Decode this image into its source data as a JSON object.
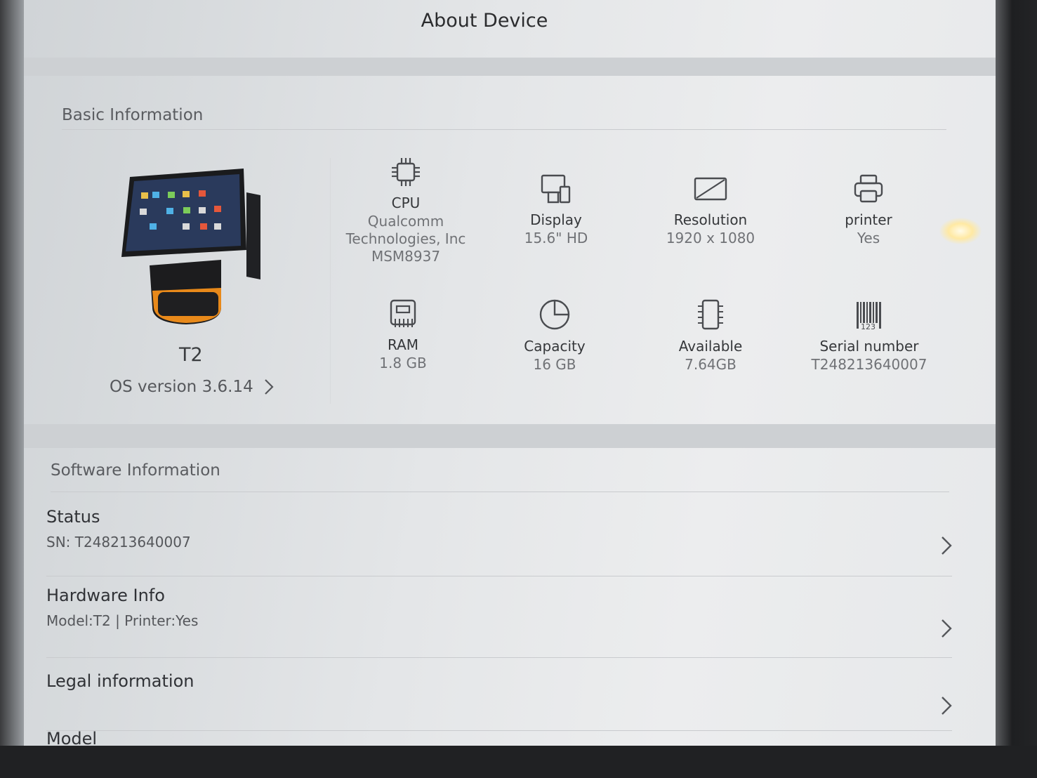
{
  "page": {
    "title": "About Device"
  },
  "basic": {
    "heading": "Basic Information",
    "device_name": "T2",
    "os_version": "OS version 3.6.14",
    "specs": [
      {
        "icon": "cpu-icon",
        "label": "CPU",
        "value": "Qualcomm\nTechnologies, Inc\nMSM8937"
      },
      {
        "icon": "display-icon",
        "label": "Display",
        "value": "15.6\" HD"
      },
      {
        "icon": "resolution-icon",
        "label": "Resolution",
        "value": "1920 x 1080"
      },
      {
        "icon": "printer-icon",
        "label": "printer",
        "value": "Yes"
      },
      {
        "icon": "ram-icon",
        "label": "RAM",
        "value": "1.8 GB"
      },
      {
        "icon": "capacity-icon",
        "label": "Capacity",
        "value": "16 GB"
      },
      {
        "icon": "available-icon",
        "label": "Available",
        "value": "7.64GB"
      },
      {
        "icon": "barcode-icon",
        "label": "Serial number",
        "value": "T248213640007"
      }
    ]
  },
  "software": {
    "heading": "Software Information",
    "rows": [
      {
        "title": "Status",
        "subtitle": "SN: T248213640007"
      },
      {
        "title": "Hardware Info",
        "subtitle": "Model:T2 | Printer:Yes"
      },
      {
        "title": "Legal information",
        "subtitle": ""
      },
      {
        "title": "Model",
        "subtitle": ""
      }
    ]
  },
  "colors": {
    "accent_orange": "#e88a1a",
    "text_dark": "#303236",
    "text_muted": "#707276"
  }
}
